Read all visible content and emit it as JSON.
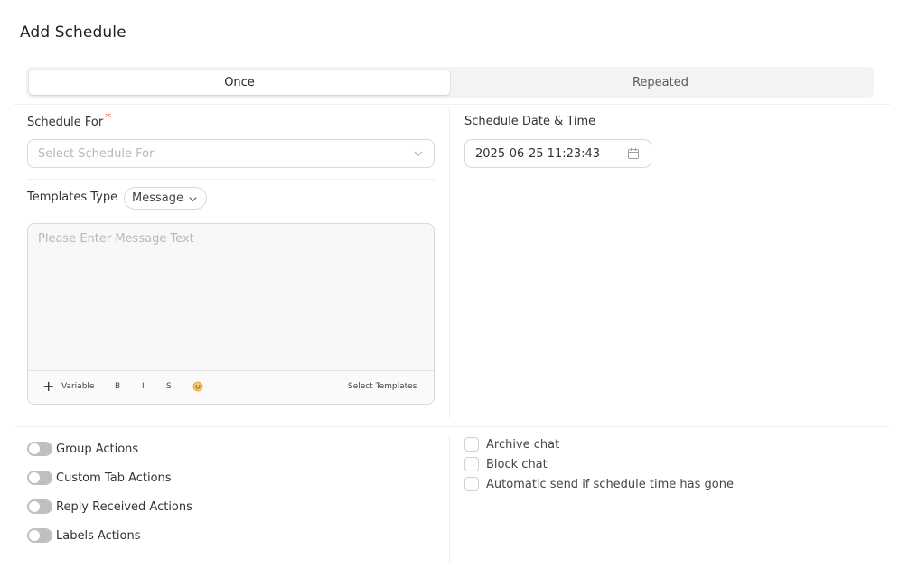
{
  "title": "Add Schedule",
  "tabs": [
    {
      "label": "Once",
      "active": true
    },
    {
      "label": "Repeated",
      "active": false
    }
  ],
  "schedule_for": {
    "label": "Schedule For",
    "required_mark": "*",
    "placeholder": "Select Schedule For"
  },
  "schedule_date": {
    "label": "Schedule Date & Time",
    "value": "2025-06-25 11:23:43"
  },
  "templates_type": {
    "label": "Templates Type",
    "selected": "Message"
  },
  "editor": {
    "placeholder": "Please Enter Message Text",
    "toolbar": {
      "plus": "+",
      "variable": "Variable",
      "bold": "B",
      "italic": "I",
      "strike": "S",
      "select_templates": "Select Templates"
    }
  },
  "toggles": [
    {
      "label": "Group Actions",
      "on": false
    },
    {
      "label": "Custom Tab Actions",
      "on": false
    },
    {
      "label": "Reply Received Actions",
      "on": false
    },
    {
      "label": "Labels Actions",
      "on": false
    }
  ],
  "checkboxes": [
    {
      "label": "Archive chat",
      "checked": false
    },
    {
      "label": "Block chat",
      "checked": false
    },
    {
      "label": "Automatic send if schedule time has gone",
      "checked": false
    }
  ],
  "icons": {
    "chevron": "chevron-down-icon",
    "calendar": "calendar-icon",
    "emoji": "emoji-icon"
  },
  "colors": {
    "required": "#ff4d4f",
    "toggle_off": "#bfbfbf",
    "border": "#d9d9d9"
  }
}
